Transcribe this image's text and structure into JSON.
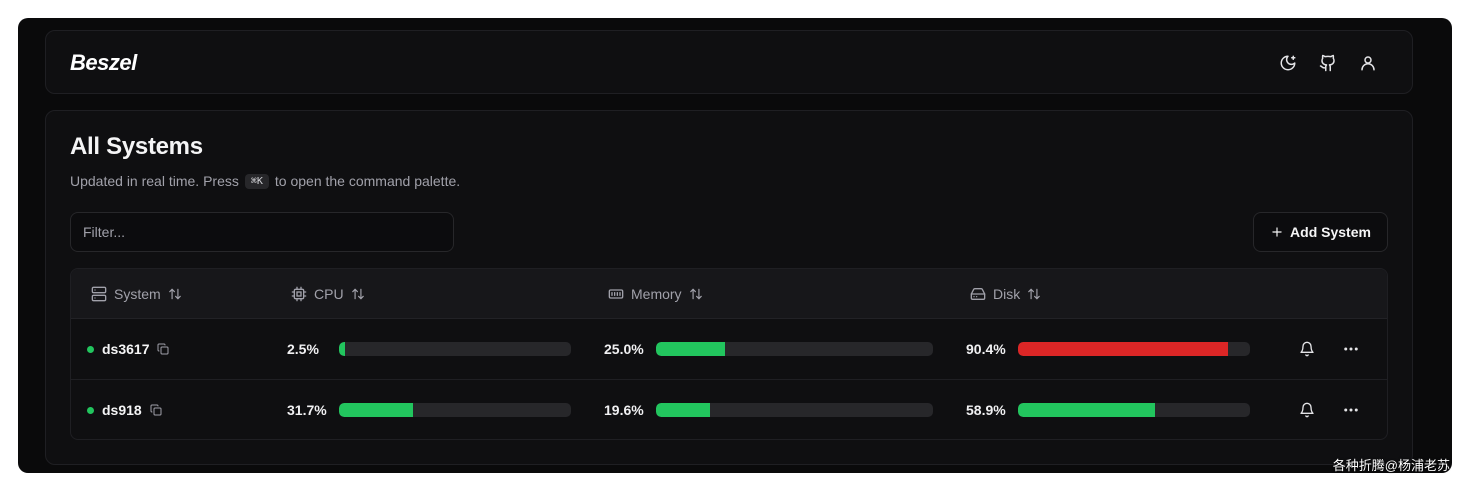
{
  "app": {
    "logo": "Beszel"
  },
  "header_icons": [
    "moon-icon",
    "github-icon",
    "user-icon"
  ],
  "page": {
    "title": "All Systems",
    "subtitle_before": "Updated in real time. Press",
    "shortcut": "⌘K",
    "subtitle_after": "to open the command palette."
  },
  "filter": {
    "placeholder": "Filter...",
    "value": ""
  },
  "add_button": {
    "label": "Add System"
  },
  "columns": [
    {
      "label": "System",
      "icon": "server-icon"
    },
    {
      "label": "CPU",
      "icon": "cpu-icon"
    },
    {
      "label": "Memory",
      "icon": "memory-icon"
    },
    {
      "label": "Disk",
      "icon": "disk-icon"
    }
  ],
  "rows": [
    {
      "name": "ds3617",
      "status": "up",
      "cpu": {
        "text": "2.5%",
        "value": 2.5
      },
      "memory": {
        "text": "25.0%",
        "value": 25.0
      },
      "disk": {
        "text": "90.4%",
        "value": 90.4
      }
    },
    {
      "name": "ds918",
      "status": "up",
      "cpu": {
        "text": "31.7%",
        "value": 31.7
      },
      "memory": {
        "text": "19.6%",
        "value": 19.6
      },
      "disk": {
        "text": "58.9%",
        "value": 58.9
      }
    }
  ],
  "colors": {
    "ok": "#22c55e",
    "critical": "#dc2626",
    "track": "#27272a"
  },
  "watermark": "各种折腾@杨浦老苏"
}
